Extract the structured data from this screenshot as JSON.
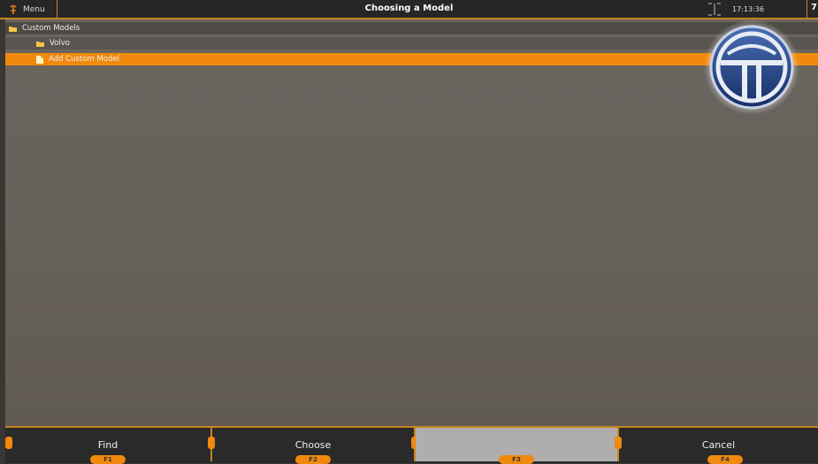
{
  "header": {
    "menu_label": "Menu",
    "title": "Choosing a Model",
    "clock": "17:13:36",
    "corner_digit": "7"
  },
  "tree": {
    "root_label": "Custom Models",
    "child_label": "Volvo",
    "selected_label": "Add Custom Model"
  },
  "function_bar": {
    "buttons": [
      {
        "label": "Find",
        "key": "F1"
      },
      {
        "label": "Choose",
        "key": "F2"
      },
      {
        "label": "",
        "key": "F3"
      },
      {
        "label": "Cancel",
        "key": "F4"
      }
    ]
  },
  "colors": {
    "accent": "#f0890c",
    "header_bg": "#262626",
    "selection": "#f0890c"
  }
}
